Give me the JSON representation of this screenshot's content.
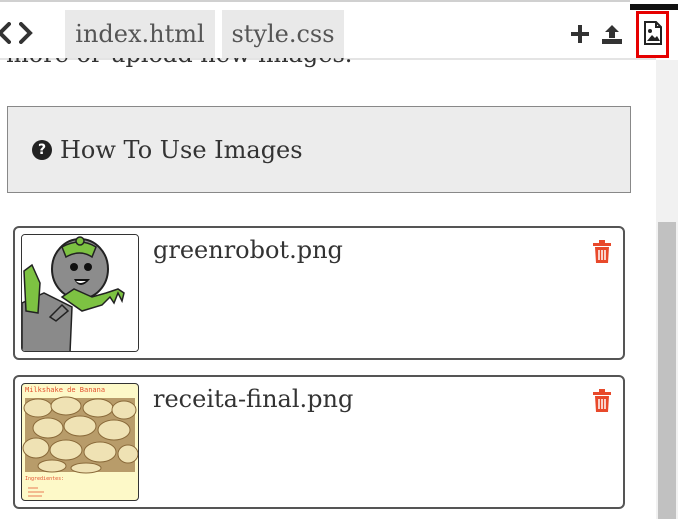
{
  "toolbar": {
    "tabs": [
      {
        "label": "index.html"
      },
      {
        "label": "style.css"
      }
    ],
    "icons": [
      "chevron-left-icon",
      "chevron-right-icon",
      "plus-icon",
      "upload-icon",
      "image-icon"
    ]
  },
  "content": {
    "partial_text": "more or upload new images.",
    "howto_label": "How To Use Images"
  },
  "images": [
    {
      "filename": "greenrobot.png"
    },
    {
      "filename": "receita-final.png",
      "thumb_title": "Milkshake de Banana",
      "thumb_caption": "Ingredientes:"
    }
  ],
  "colors": {
    "accent_red": "#e60000",
    "trash": "#e8492b",
    "robot_green": "#7dc242"
  }
}
